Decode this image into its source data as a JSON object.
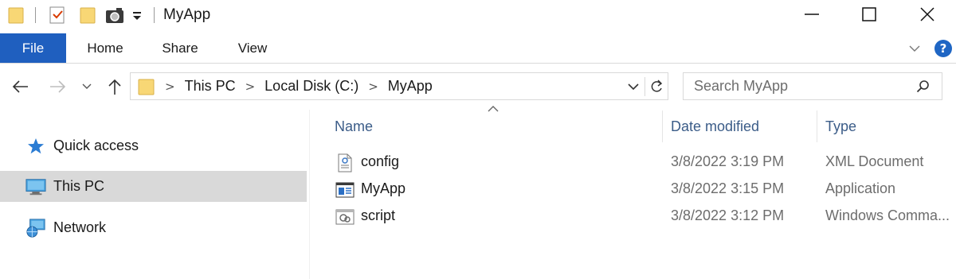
{
  "window": {
    "title": "MyApp",
    "minimize_glyph": "—",
    "maximize_glyph": "☐",
    "close_glyph": "✕"
  },
  "ribbon": {
    "tabs": [
      {
        "label": "File"
      },
      {
        "label": "Home"
      },
      {
        "label": "Share"
      },
      {
        "label": "View"
      }
    ],
    "help_glyph": "?",
    "file_tab_color": "#1f5fbf"
  },
  "address": {
    "crumbs": [
      "This PC",
      "Local Disk (C:)",
      "MyApp"
    ],
    "separator": ">"
  },
  "search": {
    "placeholder": "Search MyApp"
  },
  "sidebar": {
    "items": [
      {
        "label": "Quick access",
        "icon": "star-icon"
      },
      {
        "label": "This PC",
        "icon": "monitor-icon",
        "selected": true
      },
      {
        "label": "Network",
        "icon": "network-icon"
      }
    ]
  },
  "list": {
    "columns": {
      "name": "Name",
      "date": "Date modified",
      "type": "Type"
    },
    "sort_glyph": "^",
    "rows": [
      {
        "name": "config",
        "date": "3/8/2022 3:19 PM",
        "type": "XML Document",
        "icon": "xml-file-icon"
      },
      {
        "name": "MyApp",
        "date": "3/8/2022 3:15 PM",
        "type": "Application",
        "icon": "application-icon"
      },
      {
        "name": "script",
        "date": "3/8/2022 3:12 PM",
        "type": "Windows Comma...",
        "icon": "script-file-icon"
      }
    ]
  },
  "colors": {
    "accent": "#1f5fbf",
    "header_text": "#3b5c88",
    "selection": "#d9d9d9",
    "folder": "#f8d775"
  }
}
